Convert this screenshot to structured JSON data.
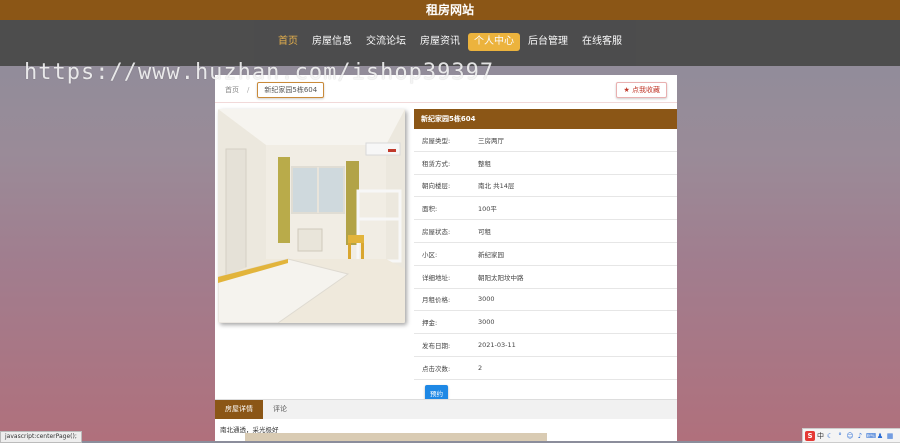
{
  "site_title": "租房网站",
  "nav": [
    {
      "label": "首页",
      "state": "home"
    },
    {
      "label": "房屋信息",
      "state": ""
    },
    {
      "label": "交流论坛",
      "state": ""
    },
    {
      "label": "房屋资讯",
      "state": ""
    },
    {
      "label": "个人中心",
      "state": "active"
    },
    {
      "label": "后台管理",
      "state": ""
    },
    {
      "label": "在线客服",
      "state": ""
    }
  ],
  "watermark": "https://www.huzhan.com/ishop39397",
  "breadcrumb": {
    "home": "首页",
    "separator": "/",
    "current": "新纪家园5栋604"
  },
  "favorite_button": "点我收藏",
  "house": {
    "title": "新纪家园5栋604",
    "fields": [
      {
        "label": "房屋类型:",
        "value": "三房两厅"
      },
      {
        "label": "租赁方式:",
        "value": "整租"
      },
      {
        "label": "朝向楼层:",
        "value": "南北 共14层"
      },
      {
        "label": "面积:",
        "value": "100平"
      },
      {
        "label": "房屋状态:",
        "value": "可租"
      },
      {
        "label": "小区:",
        "value": "新纪家园"
      },
      {
        "label": "详细地址:",
        "value": "朝阳太阳坟中路"
      },
      {
        "label": "月租价格:",
        "value": "3000"
      },
      {
        "label": "押金:",
        "value": "3000"
      },
      {
        "label": "发布日期:",
        "value": "2021-03-11"
      },
      {
        "label": "点击次数:",
        "value": "2"
      }
    ],
    "book_button": "预约"
  },
  "tabs": [
    {
      "label": "房屋详情",
      "active": true
    },
    {
      "label": "评论",
      "active": false
    }
  ],
  "description": "南北通透，采光极好",
  "status_bar": "javascript:centerPage();",
  "tray": {
    "ime": "中"
  },
  "colors": {
    "brand": "#8b5616",
    "accent": "#f0b53a",
    "button": "#1e88e5"
  }
}
